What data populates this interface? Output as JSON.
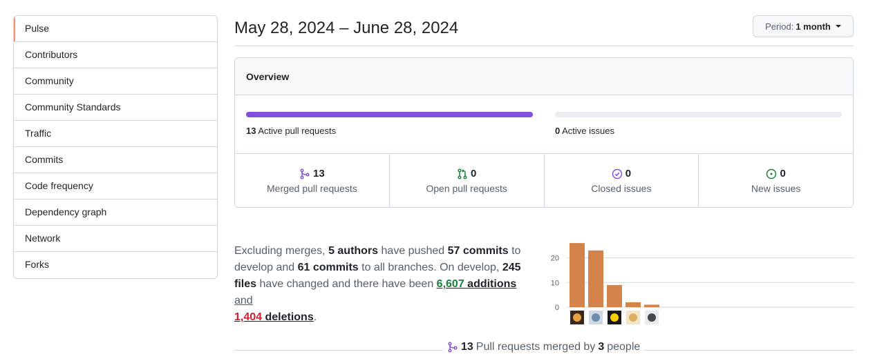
{
  "sidebar": {
    "items": [
      {
        "label": "Pulse"
      },
      {
        "label": "Contributors"
      },
      {
        "label": "Community"
      },
      {
        "label": "Community Standards"
      },
      {
        "label": "Traffic"
      },
      {
        "label": "Commits"
      },
      {
        "label": "Code frequency"
      },
      {
        "label": "Dependency graph"
      },
      {
        "label": "Network"
      },
      {
        "label": "Forks"
      }
    ]
  },
  "header": {
    "date_range": "May 28, 2024 – June 28, 2024",
    "period_label": "Period:",
    "period_value": "1 month"
  },
  "overview": {
    "title": "Overview",
    "pull_requests_count": "13",
    "pull_requests_label": "Active pull requests",
    "pull_requests_fill": 1.0,
    "issues_count": "0",
    "issues_label": "Active issues",
    "issues_fill": 0.0,
    "stats": [
      {
        "count": "13",
        "label": "Merged pull requests",
        "icon": "merge-icon"
      },
      {
        "count": "0",
        "label": "Open pull requests",
        "icon": "pull-request-icon"
      },
      {
        "count": "0",
        "label": "Closed issues",
        "icon": "issue-closed-icon"
      },
      {
        "count": "0",
        "label": "New issues",
        "icon": "issue-opened-icon"
      }
    ]
  },
  "summary": {
    "t1": "Excluding merges, ",
    "authors": "5 authors",
    "t2": " have pushed ",
    "commits_develop": "57 commits",
    "t3": " to develop and ",
    "commits_all": "61 commits",
    "t4": " to all branches. On develop, ",
    "files": "245 files",
    "t5": " have changed and there have been ",
    "additions_num": "6,607",
    "additions_word": " additions",
    "t6": " and ",
    "deletions_num": "1,404",
    "deletions_word": " deletions",
    "t7": "."
  },
  "chart_data": {
    "type": "bar",
    "categories": [
      "author-1",
      "author-2",
      "author-3",
      "author-4",
      "author-5"
    ],
    "values": [
      26,
      23,
      9,
      2,
      1
    ],
    "yticks": [
      0,
      10,
      20
    ],
    "ylim": [
      0,
      28
    ],
    "color": "#d4834a"
  },
  "footer": {
    "count": "13",
    "t1": " Pull requests merged by ",
    "people": "3",
    "t2": " people"
  },
  "colors": {
    "accent_purple": "#8250df",
    "addition_green": "#1a7f37",
    "deletion_red": "#cf222e",
    "open_green": "#1a7f37",
    "active_tab": "#fd8c73"
  }
}
